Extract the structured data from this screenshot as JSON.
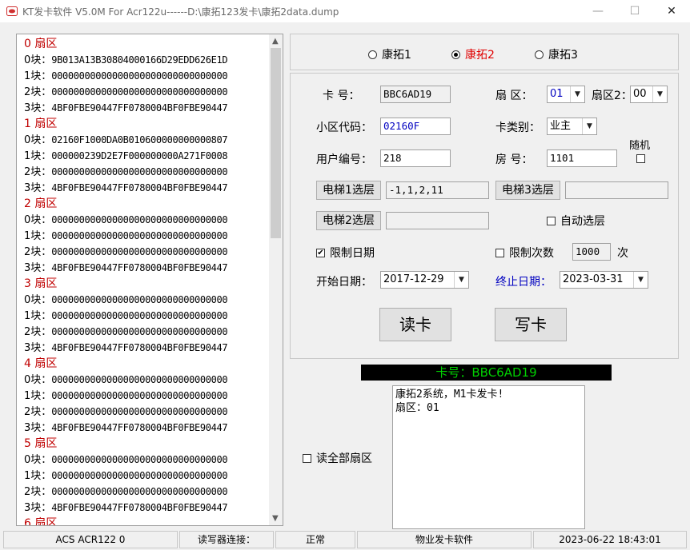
{
  "window": {
    "title": "KT发卡软件 V5.0M For Acr122u------D:\\康拓123发卡\\康拓2data.dump",
    "min": "—",
    "max": "☐",
    "close": "✕"
  },
  "sectors": [
    {
      "title": "0 扇区",
      "blocks": [
        {
          "label": "0块：",
          "data": "9B013A13B30804000166D29EDD626E1D"
        },
        {
          "label": "1块：",
          "data": "00000000000000000000000000000000"
        },
        {
          "label": "2块：",
          "data": "00000000000000000000000000000000"
        },
        {
          "label": "3块：",
          "data": "4BF0FBE90447FF0780004BF0FBE90447"
        }
      ]
    },
    {
      "title": "1 扇区",
      "blocks": [
        {
          "label": "0块：",
          "data": "02160F1000DA0B010600000000000807"
        },
        {
          "label": "1块：",
          "data": "000000239D2E7F000000000A271F0008"
        },
        {
          "label": "2块：",
          "data": "00000000000000000000000000000000"
        },
        {
          "label": "3块：",
          "data": "4BF0FBE90447FF0780004BF0FBE90447"
        }
      ]
    },
    {
      "title": "2 扇区",
      "blocks": [
        {
          "label": "0块：",
          "data": "00000000000000000000000000000000"
        },
        {
          "label": "1块：",
          "data": "00000000000000000000000000000000"
        },
        {
          "label": "2块：",
          "data": "00000000000000000000000000000000"
        },
        {
          "label": "3块：",
          "data": "4BF0FBE90447FF0780004BF0FBE90447"
        }
      ]
    },
    {
      "title": "3 扇区",
      "blocks": [
        {
          "label": "0块：",
          "data": "00000000000000000000000000000000"
        },
        {
          "label": "1块：",
          "data": "00000000000000000000000000000000"
        },
        {
          "label": "2块：",
          "data": "00000000000000000000000000000000"
        },
        {
          "label": "3块：",
          "data": "4BF0FBE90447FF0780004BF0FBE90447"
        }
      ]
    },
    {
      "title": "4 扇区",
      "blocks": [
        {
          "label": "0块：",
          "data": "00000000000000000000000000000000"
        },
        {
          "label": "1块：",
          "data": "00000000000000000000000000000000"
        },
        {
          "label": "2块：",
          "data": "00000000000000000000000000000000"
        },
        {
          "label": "3块：",
          "data": "4BF0FBE90447FF0780004BF0FBE90447"
        }
      ]
    },
    {
      "title": "5 扇区",
      "blocks": [
        {
          "label": "0块：",
          "data": "00000000000000000000000000000000"
        },
        {
          "label": "1块：",
          "data": "00000000000000000000000000000000"
        },
        {
          "label": "2块：",
          "data": "00000000000000000000000000000000"
        },
        {
          "label": "3块：",
          "data": "4BF0FBE90447FF0780004BF0FBE90447"
        }
      ]
    },
    {
      "title": "6 扇区",
      "blocks": []
    }
  ],
  "modes": {
    "options": [
      "康拓1",
      "康拓2",
      "康拓3"
    ],
    "selected": "康拓2"
  },
  "form": {
    "card_no_label": "卡    号：",
    "card_no": "BBC6AD19",
    "sector_label": "扇  区：",
    "sector_value": "01",
    "sector2_label": "扇区2：",
    "sector2_value": "00",
    "community_label": "小区代码：",
    "community_code": "02160F",
    "card_type_label": "卡类别：",
    "card_type": "业主",
    "user_no_label": "用户编号：",
    "user_no": "218",
    "room_label": "房    号：",
    "room_no": "1101",
    "random_label": "随机",
    "elevator1_button": "电梯1选层",
    "elevator1_value": "-1,1,2,11",
    "elevator3_button": "电梯3选层",
    "elevator3_value": "",
    "elevator2_button": "电梯2选层",
    "elevator2_value": "",
    "auto_floor_label": "自动选层",
    "limit_date_label": "限制日期",
    "limit_date_checked": true,
    "limit_count_label": "限制次数",
    "limit_count_checked": false,
    "count_value": "1000",
    "count_unit": "次",
    "start_label": "开始日期：",
    "start_date": "2017-12-29",
    "end_label": "终止日期：",
    "end_date": "2023-03-31",
    "read_button": "读卡",
    "write_button": "写卡"
  },
  "banner": "卡号：BBC6AD19",
  "log": [
    "康拓2系统，M1卡发卡!",
    "扇区：01"
  ],
  "read_all_label": "读全部扇区",
  "status": [
    "ACS ACR122 0",
    "读写器连接：",
    "正常",
    "物业发卡软件",
    "2023-06-22 18:43:01"
  ],
  "colors": {
    "sector_title": "#c00000",
    "selected_mode": "#e00000",
    "banner_text": "#00d000",
    "end_label": "#0000c0"
  }
}
